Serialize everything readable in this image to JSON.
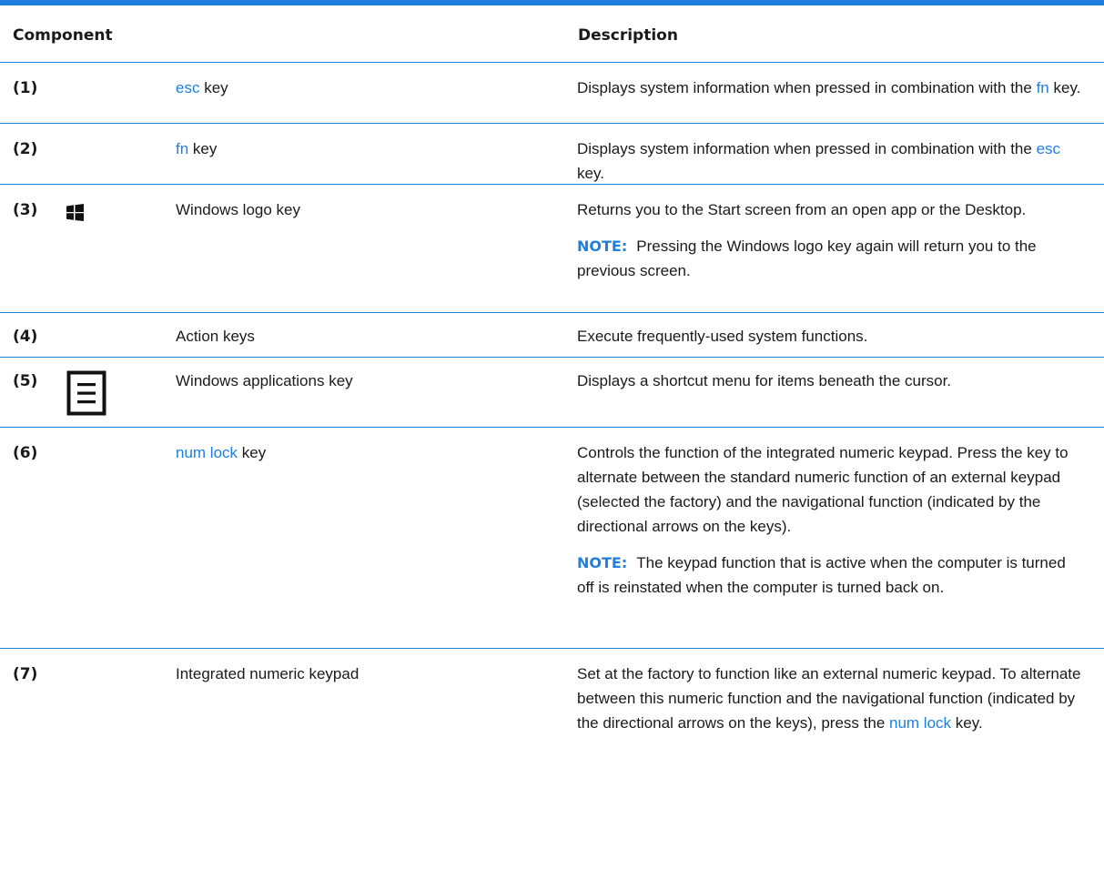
{
  "header": {
    "component": "Component",
    "description": "Description"
  },
  "note_label": "NOTE:",
  "rows": [
    {
      "num": "(1)",
      "name_link": "esc",
      "name_text": " key",
      "desc_a": "Displays system information when pressed in combination with the ",
      "desc_link": "fn",
      "desc_b": " key."
    },
    {
      "num": "(2)",
      "name_link": "fn",
      "name_text": " key",
      "desc_a": "Displays system information when pressed in combination with the ",
      "desc_link": "esc",
      "desc_b": " key."
    },
    {
      "num": "(3)",
      "icon": "windows-logo-icon",
      "name": "Windows logo key",
      "desc": "Returns you to the Start screen from an open app or the Desktop.",
      "note": "Pressing the Windows logo key again will return you to the previous screen."
    },
    {
      "num": "(4)",
      "name": "Action keys",
      "desc": "Execute frequently-used system functions."
    },
    {
      "num": "(5)",
      "icon": "applications-menu-icon",
      "name": "Windows applications key",
      "desc": "Displays a shortcut menu for items beneath the cursor."
    },
    {
      "num": "(6)",
      "name_link": "num lock",
      "name_text": " key",
      "desc": "Controls the function of the integrated numeric keypad. Press the key to alternate between the standard numeric function of an external keypad (selected the factory) and the navigational function (indicated by the directional arrows on the keys).",
      "note": "The keypad function that is active when the computer is turned off is reinstated when the computer is turned back on."
    },
    {
      "num": "(7)",
      "name": "Integrated numeric keypad",
      "desc_a": "Set at the factory to function like an external numeric keypad. To alternate between this numeric function and the navigational function (indicated by the directional arrows on the keys), press the ",
      "desc_link": "num lock",
      "desc_b": " key."
    }
  ]
}
